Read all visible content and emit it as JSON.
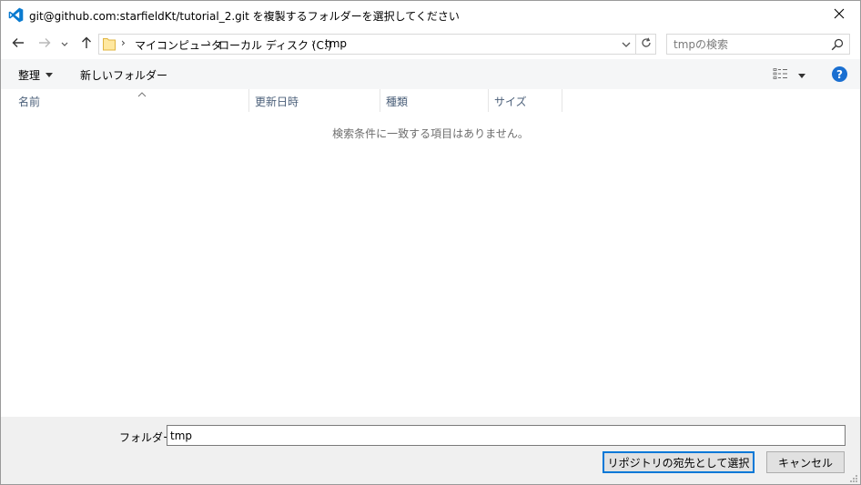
{
  "window": {
    "title": "git@github.com:starfieldKt/tutorial_2.git を複製するフォルダーを選択してください",
    "app_icon": "vscode-icon",
    "close_icon": "close-icon"
  },
  "navigation": {
    "back_icon": "back-arrow-icon",
    "forward_icon": "forward-arrow-icon",
    "recent_icon": "chevron-down-icon",
    "up_icon": "up-arrow-icon",
    "breadcrumbs": [
      "マイコンピュータ",
      "ローカル ディスク (C:)",
      "tmp"
    ],
    "refresh_icon": "refresh-icon",
    "search_placeholder": "tmpの検索"
  },
  "toolbar": {
    "organize_label": "整理",
    "new_folder_label": "新しいフォルダー",
    "view_icon": "details-view-icon",
    "help_label": "?"
  },
  "file_list": {
    "columns": [
      "名前",
      "更新日時",
      "種類",
      "サイズ"
    ],
    "empty_message": "検索条件に一致する項目はありません。"
  },
  "footer": {
    "folder_label": "フォルダー:",
    "folder_value": "tmp",
    "select_button": "リポジトリの宛先として選択",
    "cancel_button": "キャンセル"
  },
  "colors": {
    "accent": "#0078d7",
    "help": "#1a6fd1",
    "vscode_blue": "#0065a9"
  }
}
